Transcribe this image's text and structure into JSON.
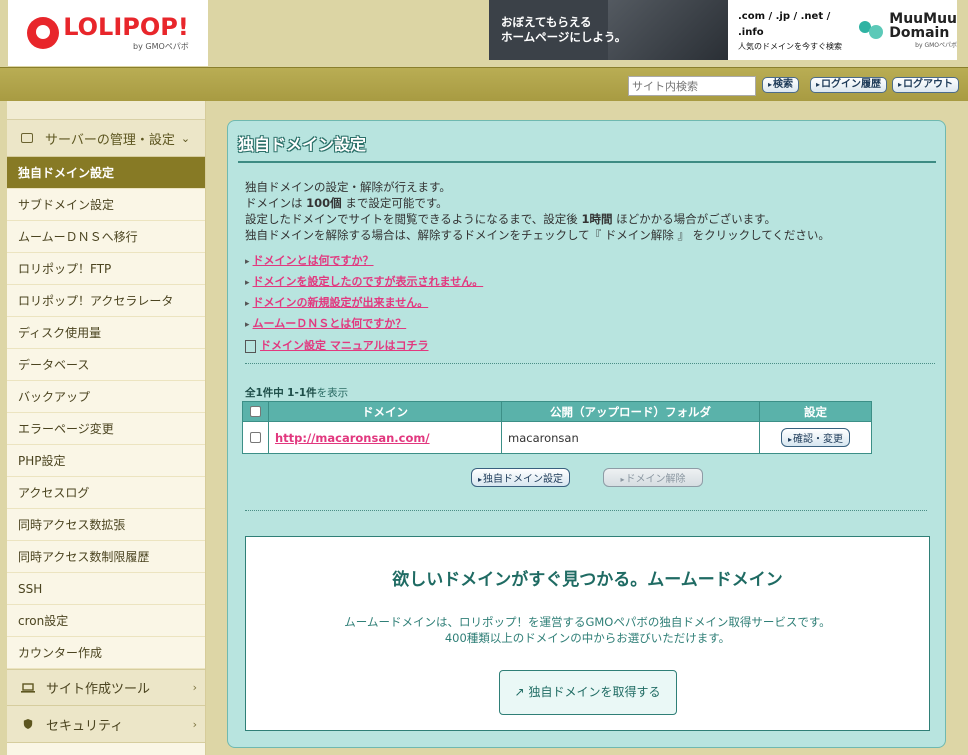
{
  "header": {
    "logo_text": "LOLIPOP!",
    "logo_sub": "by GMOペパボ",
    "banner_left_line1": "おぼえてもらえる",
    "banner_left_line2": "ホームページにしよう。",
    "banner_tlds": ".com / .jp / .net / .info",
    "banner_tagline": "人気のドメインを今すぐ検索",
    "muumuu_line1": "MuuMuu",
    "muumuu_line2": "Domain",
    "muumuu_sub": "by GMOペパボ"
  },
  "toolbar": {
    "search_placeholder": "サイト内検索",
    "search_button": "検索",
    "login_history_button": "ログイン履歴",
    "logout_button": "ログアウト"
  },
  "sidebar": {
    "server_section": "サーバーの管理・設定",
    "items": [
      "独自ドメイン設定",
      "サブドメイン設定",
      "ムームーＤＮＳへ移行",
      "ロリポップ！FTP",
      "ロリポップ！アクセラレータ",
      "ディスク使用量",
      "データベース",
      "バックアップ",
      "エラーページ変更",
      "PHP設定",
      "アクセスログ",
      "同時アクセス数拡張",
      "同時アクセス数制限履歴",
      "SSH",
      "cron設定",
      "カウンター作成"
    ],
    "site_tools_section": "サイト作成ツール",
    "security_section": "セキュリティ"
  },
  "main": {
    "title": "独自ドメイン設定",
    "intro1": "独自ドメインの設定・解除が行えます。",
    "intro2_a": "ドメインは",
    "intro2_b": "100個",
    "intro2_c": "まで設定可能です。",
    "intro3_a": "設定したドメインでサイトを閲覧できるようになるまで、設定後",
    "intro3_b": "1時間",
    "intro3_c": "ほどかかる場合がございます。",
    "intro4": "独自ドメインを解除する場合は、解除するドメインをチェックして『 ドメイン解除 』 をクリックしてください。",
    "links": [
      "ドメインとは何ですか？",
      "ドメインを設定したのですが表示されません。",
      "ドメインの新規設定が出来ません。",
      "ムームーＤＮＳとは何ですか？"
    ],
    "manual_link": "ドメイン設定 マニュアルはコチラ",
    "count_a": "全1件中",
    "count_b": "1-1件",
    "count_c": "を表示",
    "table": {
      "headers": [
        "ドメイン",
        "公開（アップロード）フォルダ",
        "設定"
      ],
      "rows": [
        {
          "domain": "http://macaronsan.com/",
          "folder": "macaronsan",
          "action": "確認・変更"
        }
      ]
    },
    "add_button": "独自ドメイン設定",
    "remove_button": "ドメイン解除"
  },
  "promo": {
    "heading": "欲しいドメインがすぐ見つかる。ムームードメイン",
    "line1": "ムームードメインは、ロリポップ！を運営するGMOペパボの独自ドメイン取得サービスです。",
    "line2": "400種類以上のドメインの中からお選びいただけます。",
    "cta": "独自ドメインを取得する"
  }
}
